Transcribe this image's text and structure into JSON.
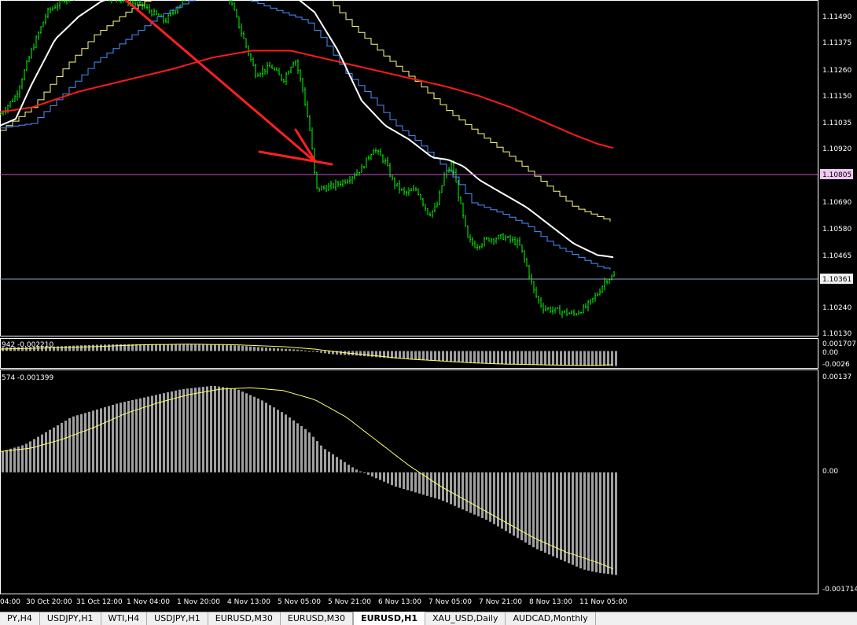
{
  "colors": {
    "background": "#000000",
    "bars": "#00ff00",
    "ma_white": "#ffffff",
    "ma_red": "#ff1a1a",
    "channel_yellow": "#ffff80",
    "channel_blue": "#4d8fff",
    "support_line": "#d050d0",
    "price_line": "#8ea2c8",
    "histogram": "#a0a0a0",
    "signal_line": "#ffff66",
    "arrow": "#ff2020"
  },
  "price_axis": {
    "ticks": [
      "1.11490",
      "1.11375",
      "1.11260",
      "1.11150",
      "1.11035",
      "1.10920",
      "1.10690",
      "1.10580",
      "1.10465",
      "1.10240",
      "1.10130"
    ],
    "tick_values": [
      1.1149,
      1.11375,
      1.1126,
      1.1115,
      1.11035,
      1.1092,
      1.1069,
      1.1058,
      1.10465,
      1.1024,
      1.1013
    ]
  },
  "levels": {
    "support": {
      "label": "1.10805",
      "value": 1.10805
    },
    "current": {
      "label": "1.10361",
      "value": 1.10361
    }
  },
  "indicator1": {
    "label": "942 -0.002210",
    "ticks": [
      "0.001707",
      "0.00",
      "-0.0026"
    ]
  },
  "indicator2": {
    "label": "574 -0.001399",
    "ticks": [
      "0.00137",
      "0.00",
      "-0.001714"
    ]
  },
  "time_axis": {
    "labels": [
      "04:00",
      "30 Oct 20:00",
      "31 Oct 12:00",
      "1 Nov 04:00",
      "1 Nov 20:00",
      "4 Nov 13:00",
      "5 Nov 05:00",
      "5 Nov 21:00",
      "6 Nov 13:00",
      "7 Nov 05:00",
      "7 Nov 21:00",
      "8 Nov 13:00",
      "11 Nov 05:00"
    ]
  },
  "tabs": [
    {
      "label": "PY,H4"
    },
    {
      "label": "USDJPY,H1"
    },
    {
      "label": "WTI,H4"
    },
    {
      "label": "USDJPY,H1"
    },
    {
      "label": "EURUSD,M30"
    },
    {
      "label": "EURUSD,M30"
    },
    {
      "label": "EURUSD,H1",
      "active": true
    },
    {
      "label": "XAU_USD,Daily"
    },
    {
      "label": "AUDCAD,Monthly"
    }
  ],
  "chart_data": {
    "type": "line",
    "symbol": "EURUSD,H1",
    "price_range": [
      1.10095,
      1.1157
    ],
    "price_series": {
      "close": [
        [
          0,
          1.1107
        ],
        [
          20,
          1.1115
        ],
        [
          40,
          1.1135
        ],
        [
          60,
          1.1152
        ],
        [
          90,
          1.116
        ],
        [
          120,
          1.116
        ],
        [
          150,
          1.1158
        ],
        [
          180,
          1.1155
        ],
        [
          210,
          1.1148
        ],
        [
          240,
          1.116
        ],
        [
          270,
          1.1166
        ],
        [
          290,
          1.116
        ],
        [
          310,
          1.114
        ],
        [
          325,
          1.1125
        ],
        [
          345,
          1.1128
        ],
        [
          360,
          1.1122
        ],
        [
          375,
          1.1132
        ],
        [
          385,
          1.1118
        ],
        [
          395,
          1.1098
        ],
        [
          402,
          1.1074
        ],
        [
          420,
          1.1075
        ],
        [
          440,
          1.1078
        ],
        [
          460,
          1.1083
        ],
        [
          475,
          1.1092
        ],
        [
          490,
          1.1086
        ],
        [
          500,
          1.1077
        ],
        [
          515,
          1.1072
        ],
        [
          530,
          1.1074
        ],
        [
          545,
          1.1063
        ],
        [
          555,
          1.1066
        ],
        [
          565,
          1.108
        ],
        [
          575,
          1.1085
        ],
        [
          585,
          1.1068
        ],
        [
          595,
          1.1052
        ],
        [
          605,
          1.1049
        ],
        [
          620,
          1.1052
        ],
        [
          640,
          1.1053
        ],
        [
          660,
          1.105
        ],
        [
          670,
          1.104
        ],
        [
          680,
          1.1028
        ],
        [
          690,
          1.1022
        ],
        [
          700,
          1.1021
        ],
        [
          715,
          1.102
        ],
        [
          730,
          1.1019
        ],
        [
          745,
          1.1022
        ],
        [
          760,
          1.1028
        ],
        [
          770,
          1.1034
        ],
        [
          782,
          1.1036
        ]
      ],
      "ma_white": [
        [
          0,
          1.1102
        ],
        [
          20,
          1.1105
        ],
        [
          40,
          1.112
        ],
        [
          70,
          1.114
        ],
        [
          100,
          1.115
        ],
        [
          130,
          1.1157
        ],
        [
          170,
          1.116
        ],
        [
          200,
          1.1163
        ],
        [
          240,
          1.1167
        ],
        [
          280,
          1.1173
        ],
        [
          320,
          1.1172
        ],
        [
          360,
          1.1163
        ],
        [
          400,
          1.1152
        ],
        [
          430,
          1.1135
        ],
        [
          460,
          1.1113
        ],
        [
          490,
          1.1102
        ],
        [
          520,
          1.1096
        ],
        [
          550,
          1.1088
        ],
        [
          570,
          1.1087
        ],
        [
          590,
          1.1084
        ],
        [
          610,
          1.1078
        ],
        [
          640,
          1.1072
        ],
        [
          670,
          1.1066
        ],
        [
          700,
          1.1058
        ],
        [
          730,
          1.105
        ],
        [
          760,
          1.1045
        ],
        [
          782,
          1.1044
        ]
      ],
      "ma_red": [
        [
          0,
          1.1108
        ],
        [
          40,
          1.111
        ],
        [
          100,
          1.1117
        ],
        [
          160,
          1.1122
        ],
        [
          220,
          1.1127
        ],
        [
          270,
          1.1132
        ],
        [
          320,
          1.1135
        ],
        [
          370,
          1.1135
        ],
        [
          420,
          1.1131
        ],
        [
          470,
          1.1127
        ],
        [
          520,
          1.1123
        ],
        [
          570,
          1.1119
        ],
        [
          610,
          1.1115
        ],
        [
          650,
          1.111
        ],
        [
          690,
          1.1104
        ],
        [
          730,
          1.1098
        ],
        [
          760,
          1.1094
        ],
        [
          782,
          1.1092
        ]
      ],
      "upper_channel": [
        [
          0,
          1.11
        ],
        [
          40,
          1.111
        ],
        [
          80,
          1.1127
        ],
        [
          120,
          1.1142
        ],
        [
          160,
          1.1152
        ],
        [
          200,
          1.116
        ],
        [
          240,
          1.1167
        ],
        [
          290,
          1.1177
        ],
        [
          330,
          1.1174
        ],
        [
          370,
          1.1168
        ],
        [
          410,
          1.116
        ],
        [
          450,
          1.1145
        ],
        [
          490,
          1.1132
        ],
        [
          530,
          1.1121
        ],
        [
          570,
          1.1108
        ],
        [
          610,
          1.1098
        ],
        [
          650,
          1.1088
        ],
        [
          690,
          1.1077
        ],
        [
          730,
          1.1066
        ],
        [
          760,
          1.1062
        ],
        [
          782,
          1.1059
        ]
      ],
      "lower_channel": [
        [
          0,
          1.1101
        ],
        [
          40,
          1.1103
        ],
        [
          80,
          1.1116
        ],
        [
          120,
          1.113
        ],
        [
          160,
          1.114
        ],
        [
          200,
          1.115
        ],
        [
          240,
          1.1157
        ],
        [
          280,
          1.1163
        ],
        [
          310,
          1.1158
        ],
        [
          350,
          1.1153
        ],
        [
          390,
          1.1148
        ],
        [
          410,
          1.114
        ],
        [
          440,
          1.1125
        ],
        [
          470,
          1.1115
        ],
        [
          500,
          1.1103
        ],
        [
          530,
          1.1095
        ],
        [
          560,
          1.1085
        ],
        [
          580,
          1.1078
        ],
        [
          600,
          1.1068
        ],
        [
          640,
          1.1063
        ],
        [
          670,
          1.1058
        ],
        [
          700,
          1.105
        ],
        [
          730,
          1.1045
        ],
        [
          760,
          1.104
        ],
        [
          782,
          1.1038
        ]
      ]
    },
    "indicator1_series": {
      "range": [
        -0.0026,
        0.001707
      ],
      "histogram": [
        [
          0,
          0.0006
        ],
        [
          60,
          0.0007
        ],
        [
          120,
          0.001
        ],
        [
          160,
          0.0011
        ],
        [
          200,
          0.0011
        ],
        [
          260,
          0.0011
        ],
        [
          300,
          0.0009
        ],
        [
          340,
          0.0005
        ],
        [
          380,
          0.0002
        ],
        [
          420,
          -0.0005
        ],
        [
          460,
          -0.0008
        ],
        [
          500,
          -0.0012
        ],
        [
          540,
          -0.0014
        ],
        [
          580,
          -0.0018
        ],
        [
          620,
          -0.002
        ],
        [
          660,
          -0.0022
        ],
        [
          700,
          -0.0023
        ],
        [
          740,
          -0.0024
        ],
        [
          782,
          -0.0024
        ]
      ],
      "signal": [
        [
          0,
          0.0003
        ],
        [
          60,
          0.0005
        ],
        [
          120,
          0.0007
        ],
        [
          180,
          0.001
        ],
        [
          240,
          0.0011
        ],
        [
          300,
          0.001
        ],
        [
          360,
          0.0007
        ],
        [
          400,
          0.0003
        ],
        [
          440,
          -0.0003
        ],
        [
          480,
          -0.0008
        ],
        [
          520,
          -0.0013
        ],
        [
          560,
          -0.0016
        ],
        [
          600,
          -0.0019
        ],
        [
          640,
          -0.0021
        ],
        [
          680,
          -0.0022
        ],
        [
          720,
          -0.0023
        ],
        [
          760,
          -0.0023
        ],
        [
          782,
          -0.0022
        ]
      ]
    },
    "indicator2_series": {
      "range": [
        -0.001714,
        0.00137
      ],
      "histogram": [
        [
          0,
          0.0003
        ],
        [
          30,
          0.0004
        ],
        [
          60,
          0.0006
        ],
        [
          90,
          0.0008
        ],
        [
          120,
          0.0009
        ],
        [
          150,
          0.001
        ],
        [
          190,
          0.0011
        ],
        [
          230,
          0.0012
        ],
        [
          270,
          0.00125
        ],
        [
          300,
          0.0012
        ],
        [
          330,
          0.00105
        ],
        [
          360,
          0.00085
        ],
        [
          390,
          0.0006
        ],
        [
          410,
          0.00035
        ],
        [
          430,
          0.0002
        ],
        [
          450,
          5e-05
        ],
        [
          470,
          -5e-05
        ],
        [
          500,
          -0.0002
        ],
        [
          530,
          -0.0003
        ],
        [
          560,
          -0.0004
        ],
        [
          590,
          -0.00055
        ],
        [
          620,
          -0.0007
        ],
        [
          650,
          -0.0009
        ],
        [
          680,
          -0.0011
        ],
        [
          710,
          -0.00125
        ],
        [
          740,
          -0.0014
        ],
        [
          760,
          -0.00145
        ],
        [
          782,
          -0.00148
        ]
      ],
      "signal": [
        [
          0,
          0.0003
        ],
        [
          40,
          0.00035
        ],
        [
          80,
          0.00048
        ],
        [
          120,
          0.00065
        ],
        [
          160,
          0.00085
        ],
        [
          200,
          0.001
        ],
        [
          240,
          0.00112
        ],
        [
          280,
          0.0012
        ],
        [
          320,
          0.00122
        ],
        [
          360,
          0.00118
        ],
        [
          400,
          0.00105
        ],
        [
          440,
          0.0008
        ],
        [
          480,
          0.00045
        ],
        [
          520,
          0.0001
        ],
        [
          560,
          -0.0002
        ],
        [
          600,
          -0.00045
        ],
        [
          640,
          -0.0007
        ],
        [
          680,
          -0.00095
        ],
        [
          720,
          -0.00115
        ],
        [
          760,
          -0.0013
        ],
        [
          782,
          -0.0014
        ]
      ]
    }
  }
}
